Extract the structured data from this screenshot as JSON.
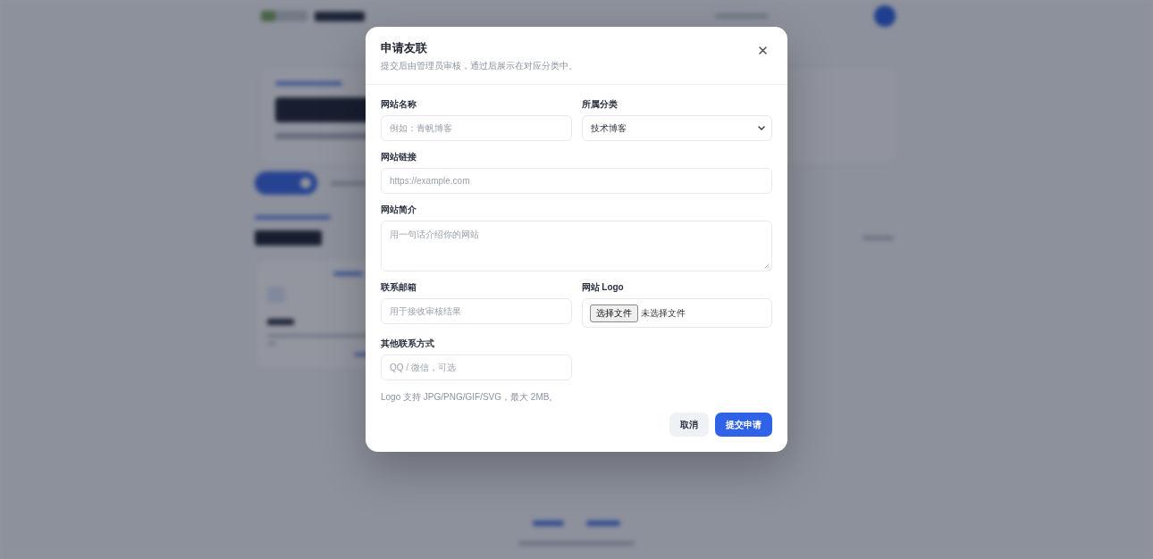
{
  "dialog": {
    "title": "申请友联",
    "subtitle": "提交后由管理员审核，通过后展示在对应分类中。"
  },
  "fields": [
    {
      "kind": "text",
      "label": "网站名称",
      "placeholder": "例如：青帆博客"
    },
    {
      "kind": "select",
      "label": "所属分类",
      "value": "技术博客"
    },
    {
      "kind": "url",
      "label": "网站链接",
      "placeholder": "https://example.com"
    },
    {
      "kind": "textarea",
      "label": "网站简介",
      "placeholder": "用一句话介绍你的网站"
    },
    {
      "kind": "email",
      "label": "联系邮箱",
      "placeholder": "用于接收审核结果"
    },
    {
      "kind": "file",
      "label": "网站 Logo",
      "button": "选择文件",
      "status": "未选择文件"
    },
    {
      "kind": "text",
      "label": "其他联系方式",
      "placeholder": "QQ / 微信，可选"
    }
  ],
  "hint": "Logo 支持 JPG/PNG/GIF/SVG，最大 2MB。",
  "buttons": [
    {
      "kind": "secondary",
      "label": "取消"
    },
    {
      "kind": "primary",
      "label": "提交申请"
    }
  ]
}
